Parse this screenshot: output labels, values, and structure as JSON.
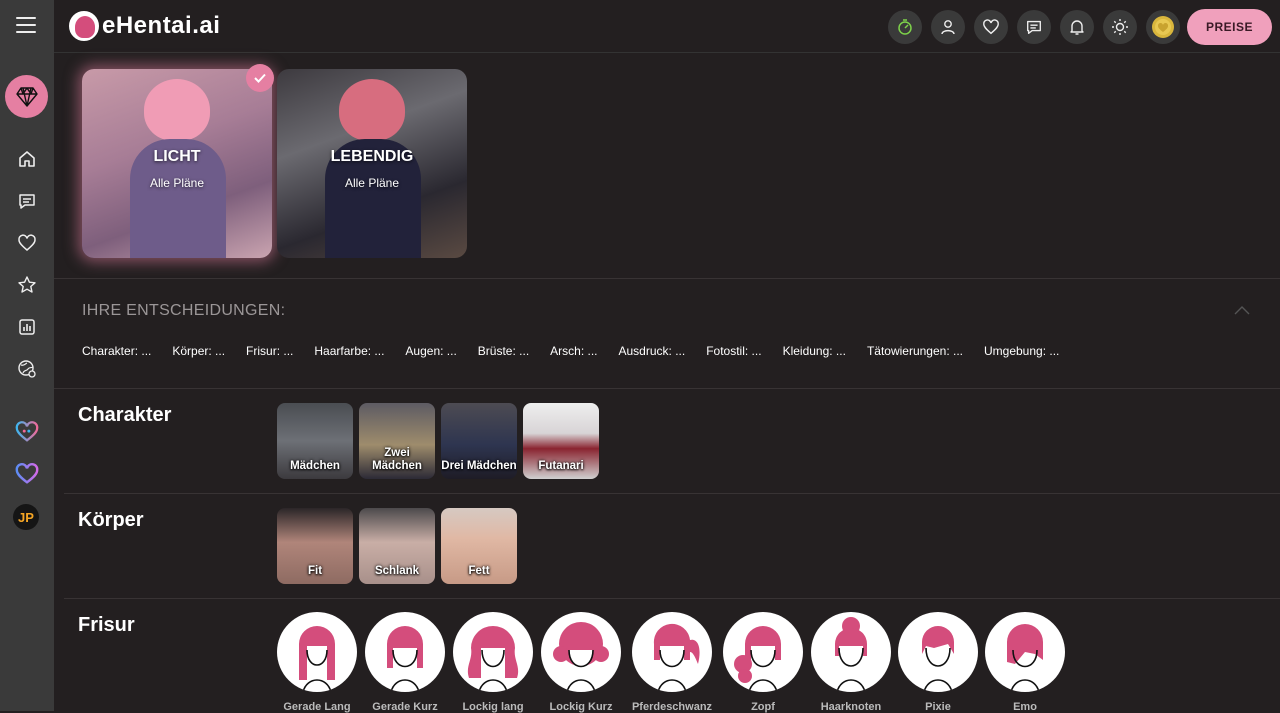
{
  "app": {
    "logo_text": "eHentai.ai"
  },
  "header": {
    "pricing_label": "PREISE",
    "icons": [
      "speed-icon",
      "user-icon",
      "heart-icon",
      "chat-icon",
      "bell-icon",
      "sun-icon",
      "coin-icon"
    ]
  },
  "sidebar": {
    "icons": [
      "menu-icon",
      "diamond-icon",
      "home-icon",
      "chat-icon",
      "heart-icon",
      "star-icon",
      "chart-icon",
      "globe-icon",
      "heart-outline-icon",
      "heart-gradient-icon"
    ],
    "jp_label": "JP"
  },
  "styles": [
    {
      "label": "LICHT",
      "sub": "Alle Pläne",
      "selected": true
    },
    {
      "label": "LEBENDIG",
      "sub": "Alle Pläne",
      "selected": false
    }
  ],
  "decisions": {
    "title": "IHRE ENTSCHEIDUNGEN:",
    "items": [
      "Charakter: ...",
      "Körper: ...",
      "Frisur: ...",
      "Haarfarbe: ...",
      "Augen: ...",
      "Brüste: ...",
      "Arsch: ...",
      "Ausdruck: ...",
      "Fotostil: ...",
      "Kleidung: ...",
      "Tätowierungen: ...",
      "Umgebung: ..."
    ]
  },
  "sections": {
    "character": {
      "title": "Charakter",
      "options": [
        "Mädchen",
        "Zwei Mädchen",
        "Drei Mädchen",
        "Futanari"
      ]
    },
    "body": {
      "title": "Körper",
      "options": [
        "Fit",
        "Schlank",
        "Fett"
      ]
    },
    "hairstyle": {
      "title": "Frisur",
      "options": [
        "Gerade Lang",
        "Gerade Kurz",
        "Lockig lang",
        "Lockig Kurz",
        "Pferdeschwanz",
        "Zopf",
        "Haarknoten",
        "Pixie",
        "Emo"
      ]
    }
  },
  "colors": {
    "accent": "#e57fa2",
    "hair": "#d44d7c",
    "background": "#231f20",
    "sidebar": "#3a3a3a"
  }
}
